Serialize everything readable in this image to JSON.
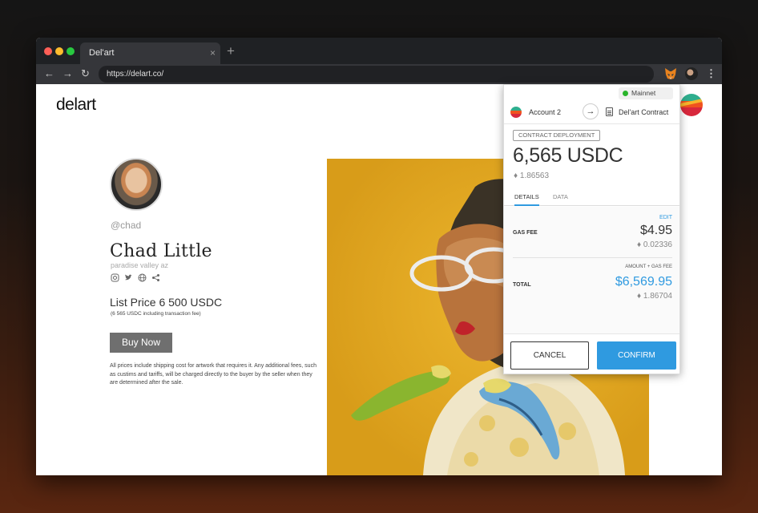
{
  "browser": {
    "tab_title": "Del'art",
    "tab_close": "×",
    "new_tab": "+",
    "url": "https://delart.co/",
    "back": "←",
    "forward": "→",
    "reload": "↻",
    "menu": "⋮"
  },
  "site": {
    "logo": "delart",
    "artist": {
      "handle": "@chad",
      "name": "Chad Little",
      "location": "paradise valley az"
    },
    "list_price": "List Price 6 500 USDC",
    "fee_note": "(6 565 USDC including transaction fee)",
    "buy_button": "Buy Now",
    "shipping_note": "All prices include shipping cost for artwork that requires it. Any additional fees, such as custims and tariffs, will be charged directly to the buyer by the seller when they are determined after the sale."
  },
  "wallet": {
    "network": "Mainnet",
    "account": "Account 2",
    "arrow": "→",
    "contract": "Del'art Contract",
    "badge": "CONTRACT DEPLOYMENT",
    "amount": "6,565 USDC",
    "amount_eth": "♦ 1.86563",
    "tabs": [
      "DETAILS",
      "DATA"
    ],
    "edit": "EDIT",
    "gas_label": "GAS FEE",
    "gas_usd": "$4.95",
    "gas_eth": "♦ 0.02336",
    "amount_gas_label": "AMOUNT + GAS FEE",
    "total_label": "TOTAL",
    "total_usd": "$6,569.95",
    "total_eth": "♦  1.86704",
    "cancel": "CANCEL",
    "confirm": "CONFIRM"
  },
  "colors": {
    "accent": "#2f9ae0",
    "network_dot": "#29b42b",
    "artwork_bg": "#e8ad1e"
  }
}
